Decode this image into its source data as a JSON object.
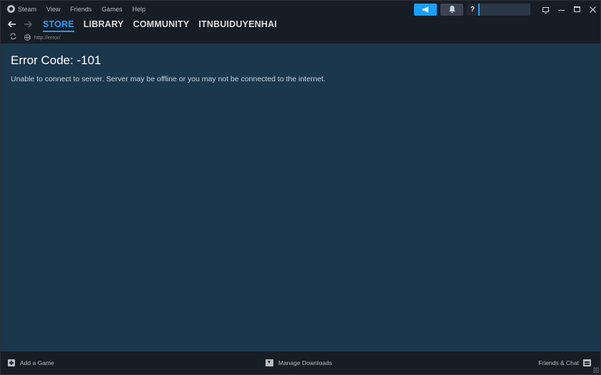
{
  "menubar": {
    "items": [
      "Steam",
      "View",
      "Friends",
      "Games",
      "Help"
    ],
    "help_label": "?"
  },
  "nav": {
    "links": [
      "STORE",
      "LIBRARY",
      "COMMUNITY",
      "ITNBUIDUYENHAI"
    ],
    "active": "STORE"
  },
  "urlbar": {
    "url": "http://error/"
  },
  "content": {
    "error_title": "Error Code: -101",
    "error_message": "Unable to connect to server. Server may be offline or you may not be connected to the internet."
  },
  "footer": {
    "add_game": "Add a Game",
    "manage_downloads": "Manage Downloads",
    "friends_chat": "Friends & Chat"
  },
  "colors": {
    "accent": "#1a9fff",
    "content_bg": "#1b374c",
    "chrome_bg": "#171d25"
  },
  "icons": {
    "back": "arrow-left-icon",
    "forward": "arrow-right-icon",
    "reload": "reload-icon",
    "globe": "globe-icon",
    "announce": "megaphone-icon",
    "notifications": "bell-icon"
  }
}
